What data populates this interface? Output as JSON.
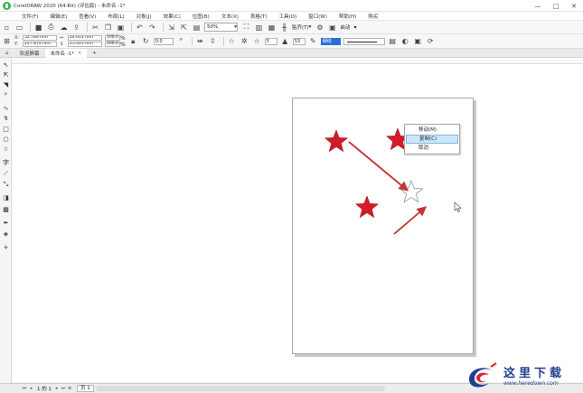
{
  "window": {
    "title": "CorelDRAW 2020 (64-Bit) (评估版) - 未命名 -1*",
    "minimize": "—",
    "maximize": "□",
    "close": "✕"
  },
  "menu": [
    "文件(F)",
    "编辑(E)",
    "查看(V)",
    "布局(L)",
    "对象(J)",
    "效果(C)",
    "位图(B)",
    "文本(X)",
    "表格(T)",
    "工具(O)",
    "窗口(W)",
    "帮助(H)",
    "购买"
  ],
  "toolbar": {
    "zoom": "50%",
    "snap": "贴齐(T)",
    "launch": "启动"
  },
  "property_bar": {
    "x": "52.789 mm",
    "y": "247.874 mm",
    "width": "24.001 mm",
    "height": "25.005 mm",
    "scale_x": "100.0",
    "scale_y": "100.0",
    "angle": "0.0",
    "points": "5",
    "sharpness": "53",
    "outline": "细线"
  },
  "tabs": {
    "welcome": "欢迎屏幕",
    "document": "未命名 -1*"
  },
  "context_menu": {
    "items": [
      "移动(M)",
      "复制(C)",
      "取消"
    ]
  },
  "status": {
    "page_count": "1 的 1",
    "page_tab": "页 1"
  },
  "watermark": {
    "cn": "这里下载",
    "url": "www.heredown.com"
  },
  "colors": {
    "star_fill": "#d31c27",
    "arrow": "#c23535",
    "accent": "#2b6fd6"
  }
}
